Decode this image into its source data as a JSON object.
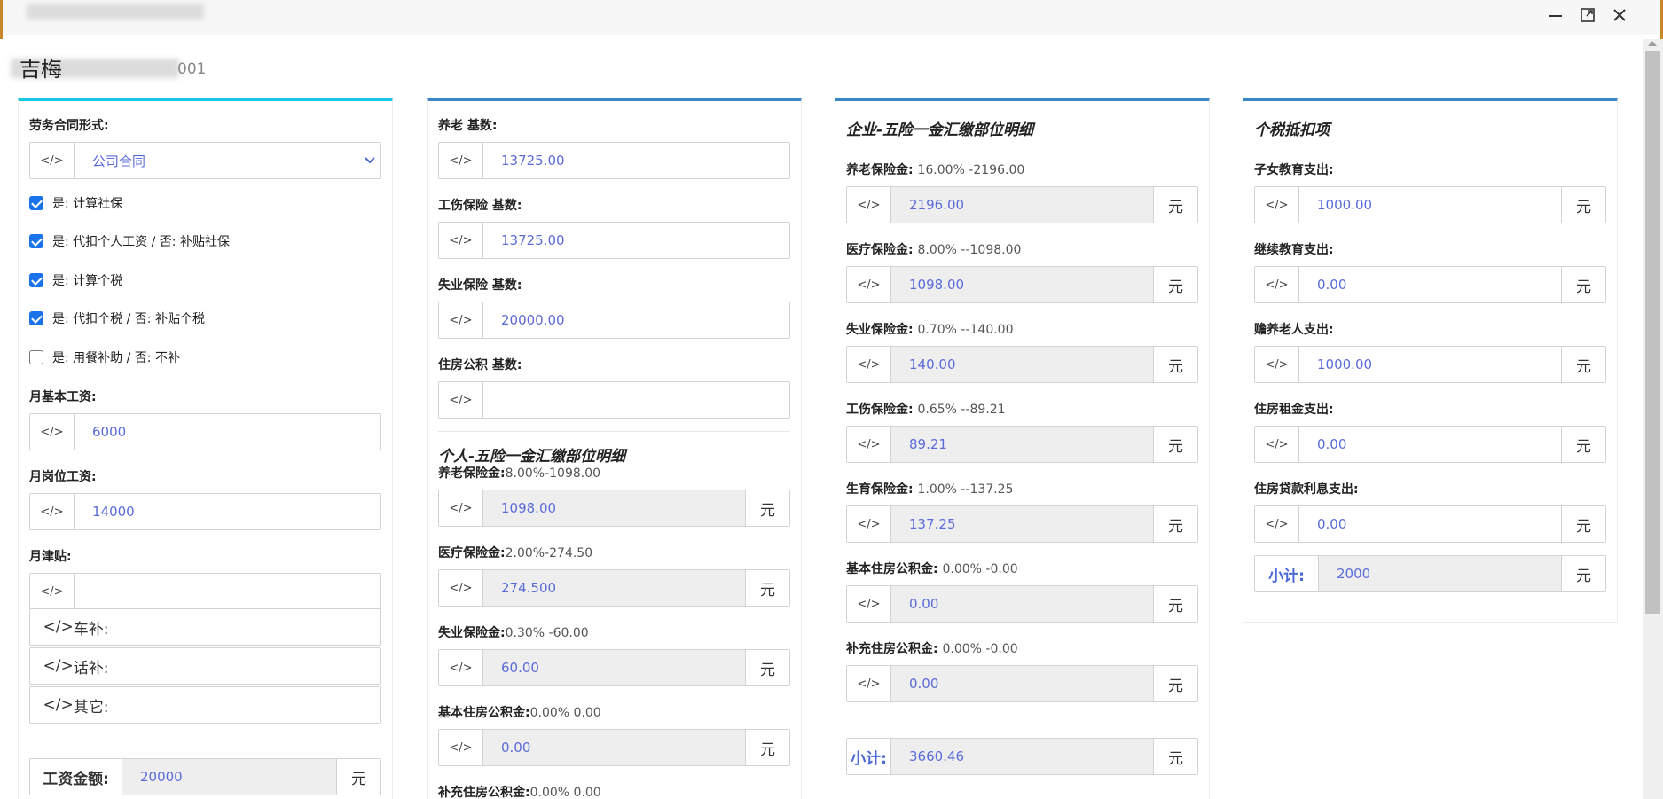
{
  "window": {
    "blurred_title": "",
    "heading_main": "吉梅",
    "heading_sub": "001"
  },
  "panel1": {
    "contract_label": "劳务合同形式:",
    "contract_value": "公司合同",
    "checkboxes": [
      {
        "label": "是: 计算社保",
        "checked": true
      },
      {
        "label": "是: 代扣个人工资 / 否: 补贴社保",
        "checked": true
      },
      {
        "label": "是: 计算个税",
        "checked": true
      },
      {
        "label": "是: 代扣个税 / 否: 补贴个税",
        "checked": true
      },
      {
        "label": "是: 用餐补助 / 否: 不补",
        "checked": false
      }
    ],
    "base_salary_label": "月基本工资:",
    "base_salary_value": "6000",
    "post_salary_label": "月岗位工资:",
    "post_salary_value": "14000",
    "allowance_label": "月津贴:",
    "allowance_value": "",
    "car_label": "车补:",
    "car_value": "",
    "phone_label": "话补:",
    "phone_value": "",
    "other_label": "其它:",
    "other_value": "",
    "total_label": "工资金额:",
    "total_value": "20000",
    "unit": "元"
  },
  "panel2": {
    "pension_base_label": "养老 基数:",
    "pension_base_value": "13725.00",
    "injury_base_label": "工伤保险 基数:",
    "injury_base_value": "13725.00",
    "unemp_base_label": "失业保险 基数:",
    "unemp_base_value": "20000.00",
    "housing_base_label": "住房公积 基数:",
    "housing_base_value": "",
    "section_title": "个人-五险一金汇缴部位明细",
    "items": [
      {
        "label": "养老保险金:",
        "rate": "8.00%-1098.00",
        "value": "1098.00"
      },
      {
        "label": "医疗保险金:",
        "rate": "2.00%-274.50",
        "value": "274.500"
      },
      {
        "label": "失业保险金:",
        "rate": "0.30% -60.00",
        "value": "60.00"
      },
      {
        "label": "基本住房公积金:",
        "rate": "0.00% 0.00",
        "value": "0.00"
      },
      {
        "label": "补充住房公积金:",
        "rate": "0.00% 0.00",
        "value": ""
      }
    ],
    "unit": "元"
  },
  "panel3": {
    "section_title": "企业-五险一金汇缴部位明细",
    "items": [
      {
        "label": "养老保险金:",
        "rate": "16.00% -2196.00",
        "value": "2196.00"
      },
      {
        "label": "医疗保险金:",
        "rate": "8.00% --1098.00",
        "value": "1098.00"
      },
      {
        "label": "失业保险金:",
        "rate": "0.70% --140.00",
        "value": "140.00"
      },
      {
        "label": "工伤保险金:",
        "rate": "0.65% --89.21",
        "value": "89.21"
      },
      {
        "label": "生育保险金:",
        "rate": "1.00% --137.25",
        "value": "137.25"
      },
      {
        "label": "基本住房公积金:",
        "rate": "0.00% -0.00",
        "value": "0.00"
      },
      {
        "label": "补充住房公积金:",
        "rate": "0.00% -0.00",
        "value": "0.00"
      }
    ],
    "subtotal_label": "小计:",
    "subtotal_value": "3660.46",
    "unit": "元"
  },
  "panel4": {
    "section_title": "个税抵扣项",
    "items": [
      {
        "label": "子女教育支出:",
        "value": "1000.00"
      },
      {
        "label": "继续教育支出:",
        "value": "0.00"
      },
      {
        "label": "赡养老人支出:",
        "value": "1000.00"
      },
      {
        "label": "住房租金支出:",
        "value": "0.00"
      },
      {
        "label": "住房贷款利息支出:",
        "value": "0.00"
      }
    ],
    "subtotal_label": "小计:",
    "subtotal_value": "2000",
    "unit": "元"
  },
  "icons": {
    "code": "</>",
    "minimize": "minimize-icon",
    "maximize": "maximize-icon",
    "close": "close-icon"
  },
  "colors": {
    "accent_cyan": "#17c7e4",
    "accent_blue": "#3a87c8",
    "value_text": "#5b6bd8",
    "window_accent": "#c8872b"
  }
}
